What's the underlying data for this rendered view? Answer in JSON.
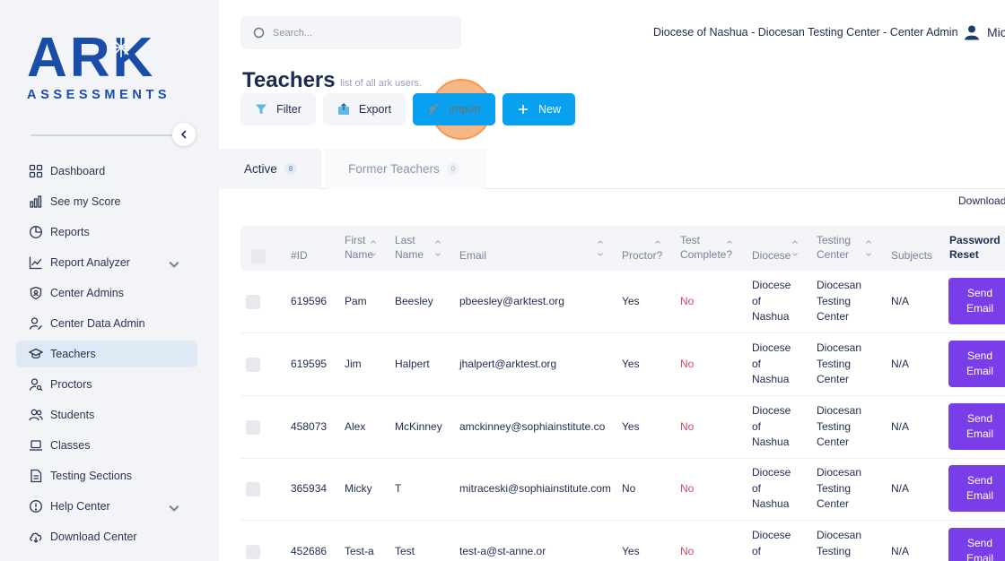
{
  "brand": {
    "logo_main": "ARK",
    "logo_sub": "ASSESSMENTS",
    "colors": {
      "primary": "#1a4da8",
      "accent": "#0aa0f0",
      "purple": "#7a3ee8",
      "danger": "#d04a5e"
    }
  },
  "sidebar": {
    "items": [
      {
        "label": "Dashboard",
        "icon": "grid-icon"
      },
      {
        "label": "See my Score",
        "icon": "bar-chart-icon"
      },
      {
        "label": "Reports",
        "icon": "pie-chart-icon"
      },
      {
        "label": "Report Analyzer",
        "icon": "line-chart-icon"
      },
      {
        "label": "Center Admins",
        "icon": "shield-icon"
      },
      {
        "label": "Center Data Admin",
        "icon": "user-edit-icon"
      },
      {
        "label": "Teachers",
        "icon": "graduation-cap-icon"
      },
      {
        "label": "Proctors",
        "icon": "user-search-icon"
      },
      {
        "label": "Students",
        "icon": "users-icon"
      },
      {
        "label": "Classes",
        "icon": "laptop-icon"
      },
      {
        "label": "Testing Sections",
        "icon": "document-icon"
      },
      {
        "label": "Help Center",
        "icon": "help-icon"
      },
      {
        "label": "Download Center",
        "icon": "cloud-download-icon"
      }
    ]
  },
  "topbar": {
    "search_placeholder": "Search...",
    "org": "Diocese of Nashua - Diocesan Testing Center - Center Admin",
    "user": "Mic"
  },
  "header": {
    "title": "Teachers",
    "subtitle": "list of all ark users.",
    "filter_label": "Filter",
    "export_label": "Export",
    "import_label": "Import",
    "new_label": "New"
  },
  "tabs": [
    {
      "label": "Active",
      "count": "8"
    },
    {
      "label": "Former Teachers",
      "count": "0"
    }
  ],
  "download_label": "Download",
  "table": {
    "columns": {
      "id": "#ID",
      "first_1": "First",
      "first_2": "Name",
      "last_1": "Last",
      "last_2": "Name",
      "email": "Email",
      "proctor": "Proctor?",
      "test_1": "Test",
      "test_2": "Complete?",
      "diocese": "Diocese",
      "tc_1": "Testing",
      "tc_2": "Center",
      "subjects": "Subjects",
      "pr_1": "Password",
      "pr_2": "Reset"
    },
    "rows": [
      {
        "id": "619596",
        "first": "Pam",
        "last": "Beesley",
        "email": "pbeesley@arktest.org",
        "proctor": "Yes",
        "complete": "No",
        "d1": "Diocese",
        "d2": "of",
        "d3": "Nashua",
        "t1": "Diocesan",
        "t2": "Testing",
        "t3": "Center",
        "subjects": "N/A",
        "b1": "Send",
        "b2": "Email"
      },
      {
        "id": "619595",
        "first": "Jim",
        "last": "Halpert",
        "email": "jhalpert@arktest.org",
        "proctor": "Yes",
        "complete": "No",
        "d1": "Diocese",
        "d2": "of",
        "d3": "Nashua",
        "t1": "Diocesan",
        "t2": "Testing",
        "t3": "Center",
        "subjects": "N/A",
        "b1": "Send",
        "b2": "Email"
      },
      {
        "id": "458073",
        "first": "Alex",
        "last": "McKinney",
        "email": "amckinney@sophiainstitute.co",
        "proctor": "Yes",
        "complete": "No",
        "d1": "Diocese",
        "d2": "of",
        "d3": "Nashua",
        "t1": "Diocesan",
        "t2": "Testing",
        "t3": "Center",
        "subjects": "N/A",
        "b1": "Send",
        "b2": "Email"
      },
      {
        "id": "365934",
        "first": "Micky",
        "last": "T",
        "email": "mitraceski@sophiainstitute.com",
        "proctor": "No",
        "complete": "No",
        "d1": "Diocese",
        "d2": "of",
        "d3": "Nashua",
        "t1": "Diocesan",
        "t2": "Testing",
        "t3": "Center",
        "subjects": "N/A",
        "b1": "Send",
        "b2": "Email"
      },
      {
        "id": "452686",
        "first": "Test-a",
        "last": "Test",
        "email": "test-a@st-anne.or",
        "proctor": "Yes",
        "complete": "No",
        "d1": "Diocese",
        "d2": "of",
        "d3": "",
        "t1": "Diocesan",
        "t2": "Testing",
        "t3": "",
        "subjects": "N/A",
        "b1": "Send",
        "b2": "Email"
      }
    ]
  }
}
